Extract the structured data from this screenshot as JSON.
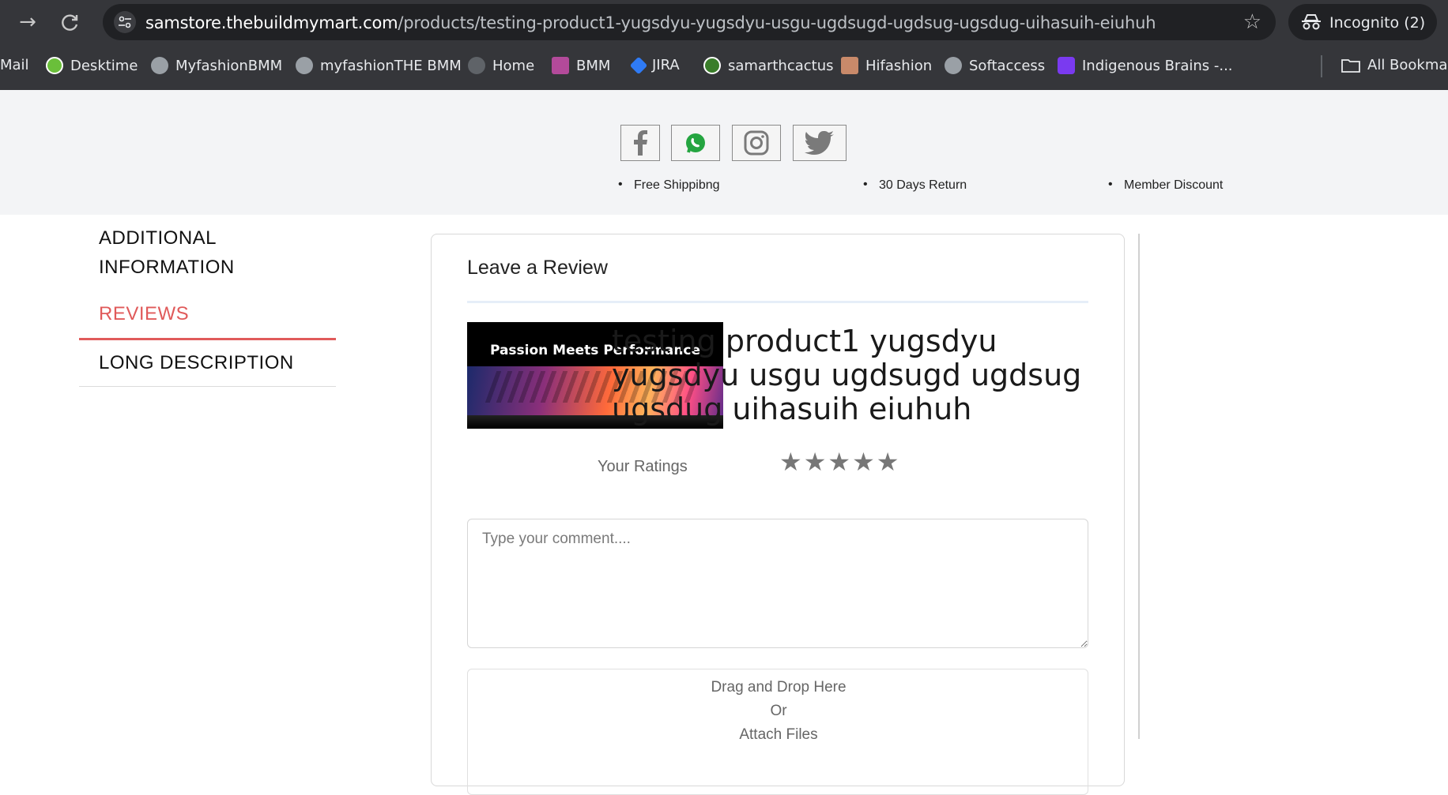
{
  "browser": {
    "url_host": "samstore.thebuildmymart.com",
    "url_path": "/products/testing-product1-yugsdyu-yugsdyu-usgu-ugdsugd-ugdsug-ugsdug-uihasuih-eiuhuh",
    "incognito_label": "Incognito (2)",
    "icons": [
      "forward-icon",
      "reload-icon",
      "site-settings-icon",
      "bookmark-star-icon",
      "incognito-icon"
    ]
  },
  "bookmarks": {
    "items": [
      {
        "label": "Mail",
        "color": "#35363a"
      },
      {
        "label": "Desktime",
        "color": "#6abf3a"
      },
      {
        "label": "MyfashionBMM",
        "color": "#9aa0a6"
      },
      {
        "label": "myfashionTHE BMM",
        "color": "#9aa0a6"
      },
      {
        "label": "Home",
        "color": "#5f6368"
      },
      {
        "label": "BMM",
        "color": "#b34a9a"
      },
      {
        "label": "JIRA",
        "color": "#2f7bf5"
      },
      {
        "label": "samarthcactus",
        "color": "#3a7d2a"
      },
      {
        "label": "Hifashion",
        "color": "#c98a6a"
      },
      {
        "label": "Softaccess",
        "color": "#9aa0a6"
      },
      {
        "label": "Indigenous Brains -...",
        "color": "#7a3af0"
      }
    ],
    "all_bookmarks": "All Bookmar"
  },
  "header": {
    "social": [
      "facebook-icon",
      "whatsapp-icon",
      "instagram-icon",
      "twitter-icon"
    ],
    "perks": [
      "Free Shippibng",
      "30 Days Return",
      "Member Discount"
    ]
  },
  "tabs": {
    "additional_line1": "ADDITIONAL",
    "additional_line2": "INFORMATION",
    "reviews": "REVIEWS",
    "long_description": "LONG DESCRIPTION",
    "active_color": "#e05a5a"
  },
  "review": {
    "title": "Leave a Review",
    "image_text": "Passion Meets Performance",
    "product_name": "testing product1 yugsdyu yugsdyu usgu ugdsugd ugdsug ugsdug uihasuih eiuhuh",
    "ratings_label": "Your Ratings",
    "stars": [
      "★",
      "★",
      "★",
      "★",
      "★"
    ],
    "comment_placeholder": "Type your comment....",
    "drop_line1": "Drag and Drop Here",
    "drop_line2": "Or",
    "drop_line3": "Attach Files"
  }
}
